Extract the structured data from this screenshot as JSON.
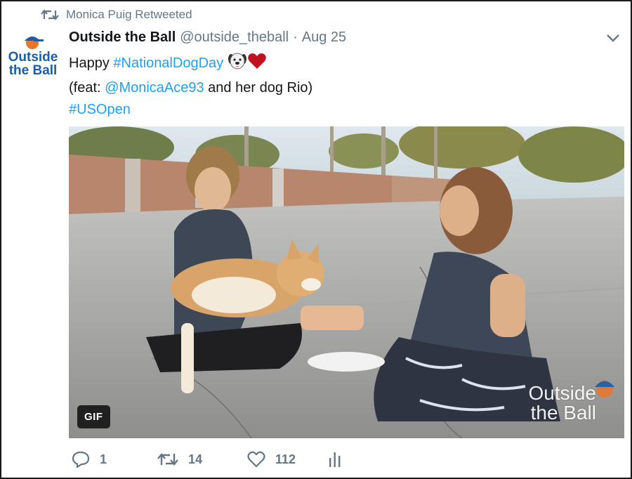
{
  "retweet_banner": {
    "text": "Monica Puig Retweeted",
    "icon": "retweet-icon"
  },
  "author": {
    "display_name": "Outside the Ball",
    "handle": "@outside_theball",
    "separator": "·",
    "date": "Aug 25",
    "avatar_text_line1": "Outside",
    "avatar_text_line2": "the Ball"
  },
  "tweet": {
    "line1_prefix": "Happy ",
    "line1_hashtag": "#NationalDogDay",
    "line2_prefix": "(feat: ",
    "line2_mention": "@MonicaAce93",
    "line2_suffix": " and her dog Rio)",
    "line3_hashtag": "#USOpen",
    "emojis": [
      "dog-face-icon",
      "red-heart-icon"
    ]
  },
  "media": {
    "badge": "GIF",
    "watermark_line1": "Outside",
    "watermark_line2": "the Ball"
  },
  "actions": {
    "reply_count": "1",
    "retweet_count": "14",
    "like_count": "112"
  },
  "colors": {
    "link": "#1da1f2",
    "muted": "#657786",
    "text": "#14171a",
    "brand_blue": "#1a5fa8",
    "brand_orange": "#e8762b"
  }
}
